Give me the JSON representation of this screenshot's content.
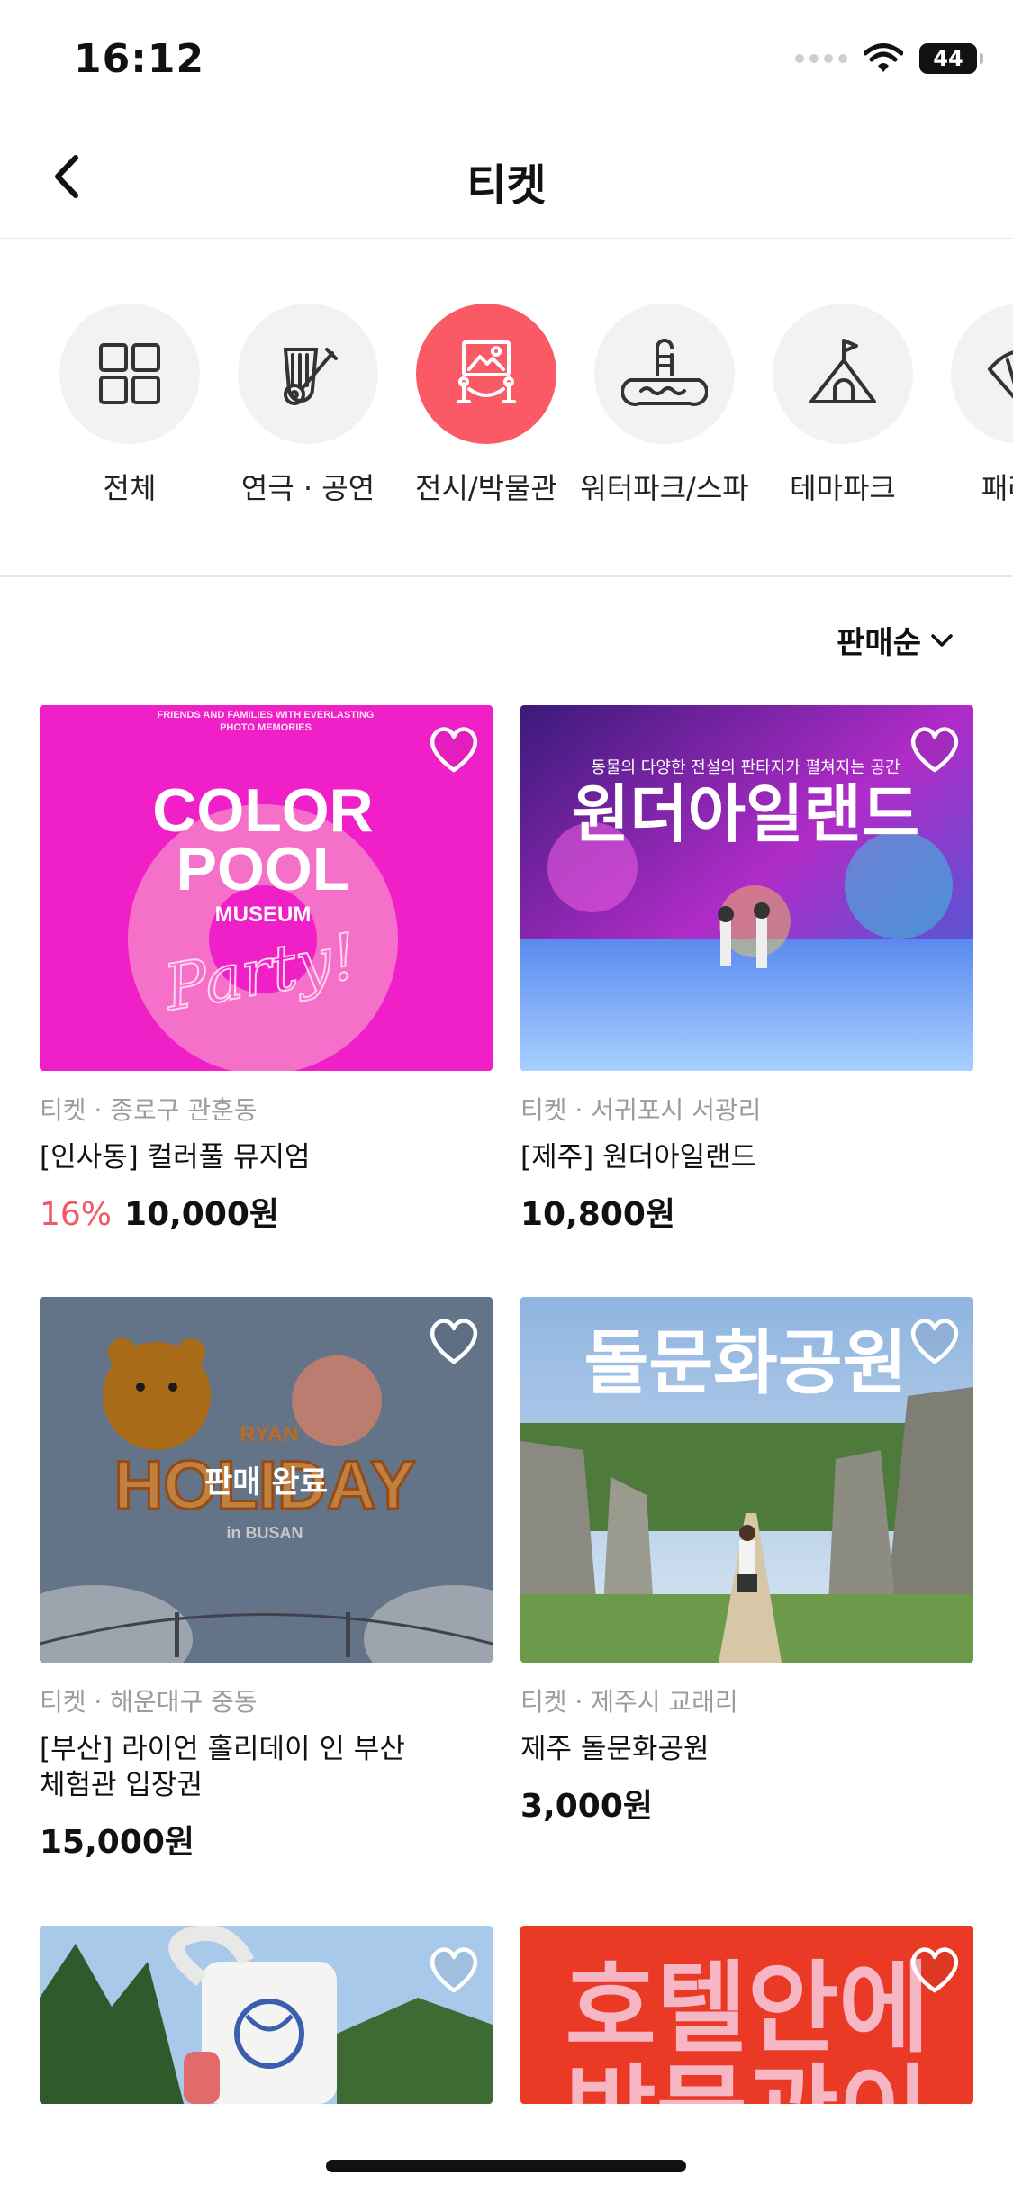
{
  "status_bar": {
    "time": "16:12",
    "battery": "44"
  },
  "header": {
    "title": "티켓"
  },
  "categories": [
    {
      "label": "전체",
      "icon": "grid-icon"
    },
    {
      "label": "연극 · 공연",
      "icon": "instruments-icon"
    },
    {
      "label": "전시/박물관",
      "icon": "exhibition-icon",
      "active": true
    },
    {
      "label": "워터파크/스파",
      "icon": "waterpark-icon"
    },
    {
      "label": "테마파크",
      "icon": "castle-icon"
    },
    {
      "label": "패러글",
      "icon": "paraglider-icon"
    }
  ],
  "sort": {
    "label": "판매순"
  },
  "colors": {
    "accent": "#fa5a66",
    "discount": "#f25766",
    "meta": "#9c9c9c"
  },
  "products": [
    {
      "meta": "티켓 · 종로구 관훈동",
      "title": "[인사동] 컬러풀 뮤지엄",
      "discount": "16%",
      "price": "10,000원",
      "image_text": {
        "top": "FRIENDS AND FAMILIES WITH EVERLASTING",
        "top2": "PHOTO MEMORIES",
        "line1": "COLOR",
        "line2": "POOL",
        "line3": "MUSEUM",
        "script": "Party!"
      }
    },
    {
      "meta": "티켓 · 서귀포시 서광리",
      "title": "[제주] 원더아일랜드",
      "price": "10,800원",
      "image_text": {
        "subtitle": "동물의 다양한 전설의 판타지가 펼쳐지는 공간",
        "headline": "원더아일랜드"
      }
    },
    {
      "meta": "티켓 · 해운대구 중동",
      "title_line1": "[부산] 라이언 홀리데이 인 부산",
      "title_line2": "체험관 입장권",
      "price": "15,000원",
      "soldout": "판매 완료",
      "image_text": {
        "tag": "RYAN",
        "headline": "HOLIDAY",
        "sub": "in BUSAN"
      }
    },
    {
      "meta": "티켓 · 제주시 교래리",
      "title": "제주 돌문화공원",
      "price": "3,000원",
      "image_text": {
        "headline": "돌문화공원"
      }
    },
    {
      "image_text": {}
    },
    {
      "image_text": {
        "line1": "호텔안에",
        "line2": "박물관이"
      }
    }
  ]
}
